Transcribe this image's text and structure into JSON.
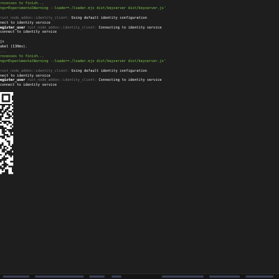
{
  "terminal": {
    "lines": [
      {
        "text": "rocesses to finish...",
        "style": "green"
      },
      {
        "text": "ngs=ExperimentalWarning --loader=./loader.mjs dist/keyserver dist/keyserver.js'",
        "style": "green"
      },
      {
        "text": "",
        "style": "white"
      },
      {
        "parts": [
          {
            "text": "rust_node_addon::identity_client: ",
            "style": "grey"
          },
          {
            "text": "Using default identity configuration",
            "style": "white"
          }
        ]
      },
      {
        "text": "nect to identity service",
        "style": "white"
      },
      {
        "parts": [
          {
            "text": "egister_user",
            "style": "bold"
          },
          {
            "text": " rust_node_addon::identity_client: ",
            "style": "grey"
          },
          {
            "text": "Connecting to identity service",
            "style": "white"
          }
        ]
      },
      {
        "text": "connect to identity service",
        "style": "white"
      },
      {
        "text": "",
        "style": "white"
      },
      {
        "text": "js",
        "style": "white"
      },
      {
        "text": "abel (130ms).",
        "style": "white"
      },
      {
        "text": "...",
        "style": "dim"
      },
      {
        "text": "rocesses to finish...",
        "style": "green"
      },
      {
        "text": "ngs=ExperimentalWarning --loader=./loader.mjs dist/keyserver dist/keyserver.js'",
        "style": "green"
      },
      {
        "text": "",
        "style": "white"
      },
      {
        "parts": [
          {
            "text": "rust_node_addon::identity_client: ",
            "style": "grey"
          },
          {
            "text": "Using default identity configuration",
            "style": "white"
          }
        ]
      },
      {
        "text": "nect to identity service",
        "style": "white"
      },
      {
        "parts": [
          {
            "text": "egister_user",
            "style": "bold"
          },
          {
            "text": " rust_node_addon::identity_client: ",
            "style": "grey"
          },
          {
            "text": "Connecting to identity service",
            "style": "white"
          }
        ]
      },
      {
        "text": "connect to identity service",
        "style": "white"
      }
    ]
  },
  "colors": {
    "background": "#1e1e1e",
    "green": "#7cc24a",
    "grey": "#7a7a7a",
    "foreground": "#ececec"
  },
  "icons": {
    "qr": "qr-code-icon"
  }
}
